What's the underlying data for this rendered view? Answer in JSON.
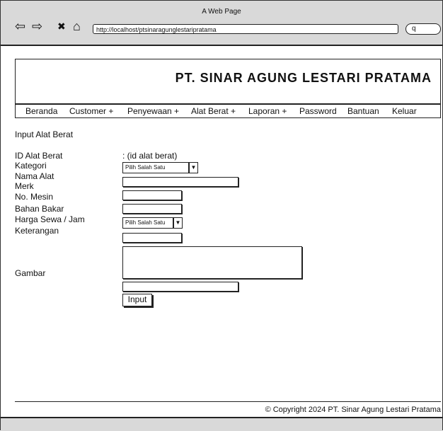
{
  "browser": {
    "window_title": "A Web Page",
    "url": "http://localhost/ptsinaragunglestaripratama",
    "back_icon": "⇦",
    "forward_icon": "⇨",
    "close_icon": "✖",
    "home_icon": "⌂",
    "search_icon": "q"
  },
  "header": {
    "company": "PT. SINAR AGUNG LESTARI PRATAMA"
  },
  "menu": {
    "items": [
      "Beranda",
      "Customer +",
      "Penyewaan +",
      "Alat Berat +",
      "Laporan +",
      "Password",
      "Bantuan",
      "Keluar"
    ]
  },
  "form": {
    "title": "Input Alat Berat",
    "labels": {
      "id": "ID Alat Berat",
      "kategori": "Kategori",
      "nama": "Nama Alat",
      "merk": "Merk",
      "mesin": "No. Mesin",
      "bahan": "Bahan Bakar",
      "harga": "Harga Sewa / Jam",
      "keterangan": "Keterangan",
      "gambar": "Gambar"
    },
    "id_value": ": (id alat berat)",
    "kategori_select": "Pilih Salah Satu",
    "harga_select": "Pilih Salah Satu",
    "submit_label": "Input"
  },
  "footer": {
    "copyright": "© Copyright 2024 PT. Sinar Agung Lestari Pratama"
  }
}
